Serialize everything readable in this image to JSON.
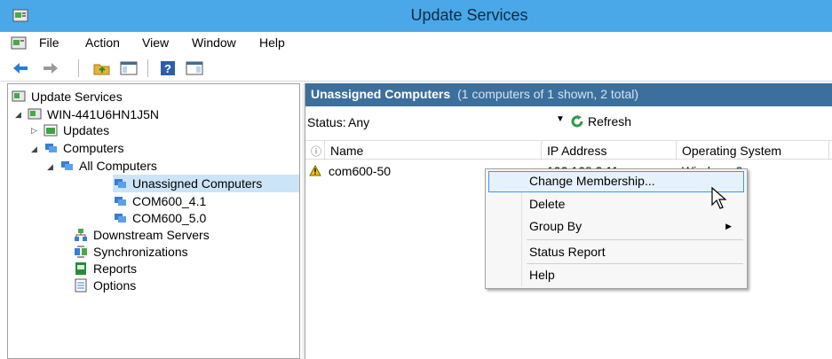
{
  "window": {
    "title": "Update Services"
  },
  "menu": {
    "items": [
      "File",
      "Action",
      "View",
      "Window",
      "Help"
    ]
  },
  "tree": {
    "root": "Update Services",
    "server": "WIN-441U6HN1J5N",
    "updates": "Updates",
    "computers": "Computers",
    "all_computers": "All Computers",
    "unassigned": "Unassigned Computers",
    "group1": "COM600_4.1",
    "group2": "COM600_5.0",
    "downstream": "Downstream Servers",
    "sync": "Synchronizations",
    "reports": "Reports",
    "options": "Options"
  },
  "pane": {
    "title": "Unassigned Computers",
    "count": "(1 computers of 1 shown, 2 total)",
    "status_label": "Status:",
    "status_value": "Any",
    "refresh_label": "Refresh"
  },
  "grid": {
    "columns": [
      "Name",
      "IP Address",
      "Operating System"
    ],
    "rows": [
      {
        "name": "com600-50",
        "ip": "192.168.2.11",
        "os": "Windows 8"
      }
    ]
  },
  "context_menu": {
    "items": [
      "Change Membership...",
      "Delete",
      "Group By",
      "Status Report",
      "Help"
    ]
  },
  "colors": {
    "titlebar": "#4aa8e8",
    "pane_header": "#3d6f9c",
    "selected": "#cce4f7",
    "hover_border": "#3399ff"
  }
}
